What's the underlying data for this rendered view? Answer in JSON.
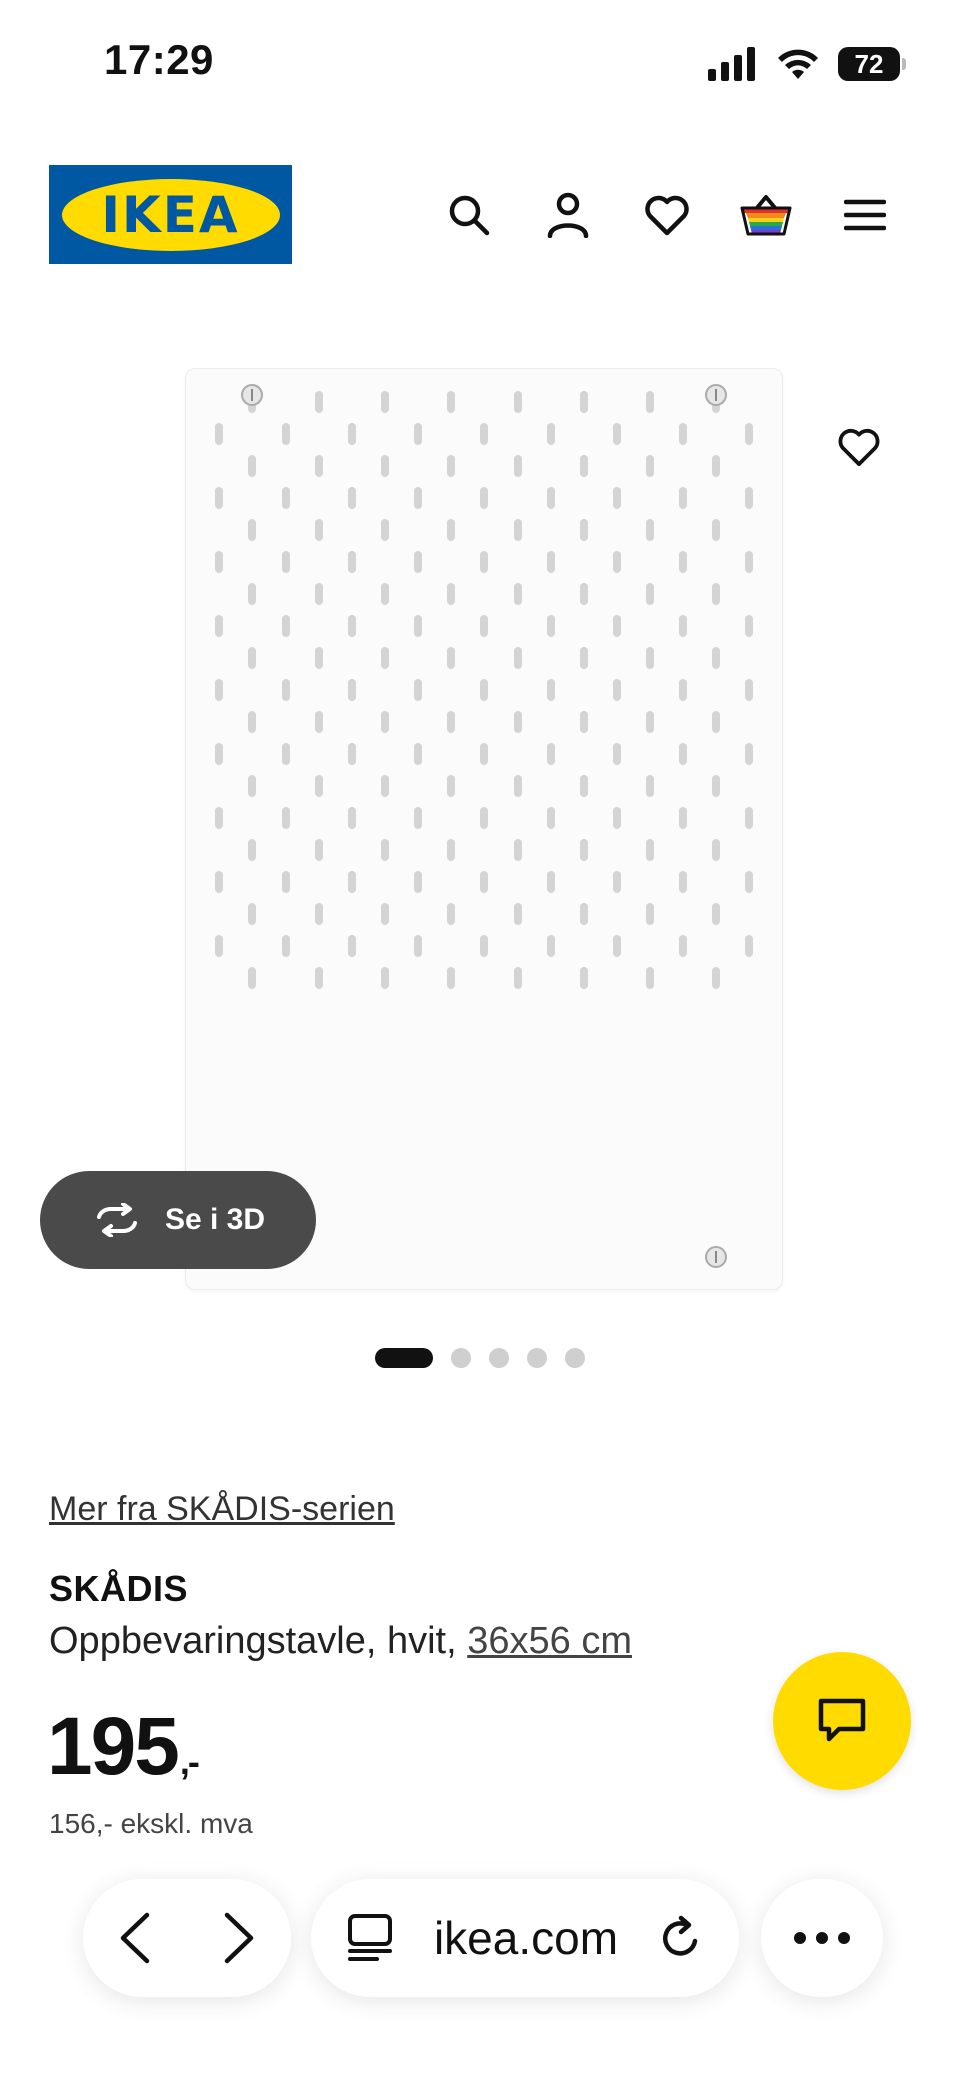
{
  "status_bar": {
    "time": "17:29",
    "battery": "72"
  },
  "header": {
    "logo_text": "IKEA",
    "logo_colors": {
      "blue": "#0058a3",
      "yellow": "#ffdb00"
    },
    "icons": [
      "search-icon",
      "account-icon",
      "favorites-icon",
      "cart-icon",
      "menu-icon"
    ]
  },
  "gallery": {
    "view_3d_label": "Se i 3D",
    "image_count": 5,
    "active_index": 0
  },
  "product": {
    "series_link": "Mer fra SKÅDIS-serien",
    "name": "SKÅDIS",
    "description": "Oppbevaringstavle, hvit, ",
    "size": "36x56 cm",
    "price_main": "195",
    "price_suffix": ",-",
    "price_ex_vat": "156,- ekskl. mva"
  },
  "browser": {
    "url": "ikea.com"
  },
  "colors": {
    "chat_button": "#ffdb00",
    "dark_button": "#4a4a4a"
  }
}
